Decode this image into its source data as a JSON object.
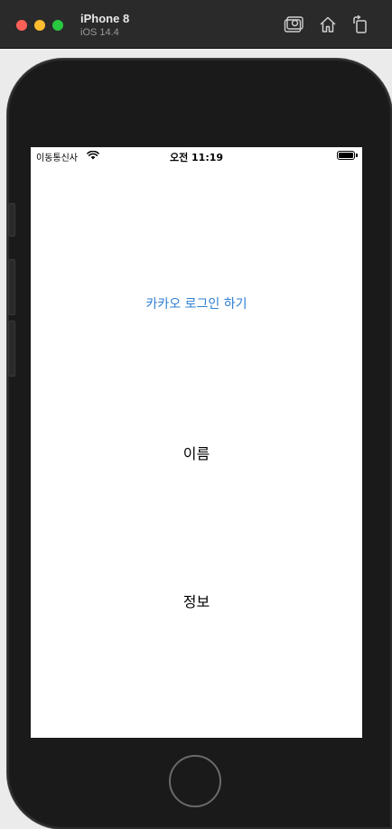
{
  "window": {
    "device_name": "iPhone 8",
    "os_version": "iOS 14.4",
    "icons": [
      "screenshot-icon",
      "home-icon",
      "rotate-icon"
    ]
  },
  "status_bar": {
    "carrier": "이동통신사",
    "time": "오전 11:19",
    "battery": 1.0
  },
  "app": {
    "kakao_login_label": "카카오 로그인 하기",
    "name_label": "이름",
    "info_label": "정보"
  },
  "colors": {
    "link_blue": "#2f7fd2",
    "device_body": "#1a1a1a",
    "titlebar": "#2b2a2b"
  }
}
